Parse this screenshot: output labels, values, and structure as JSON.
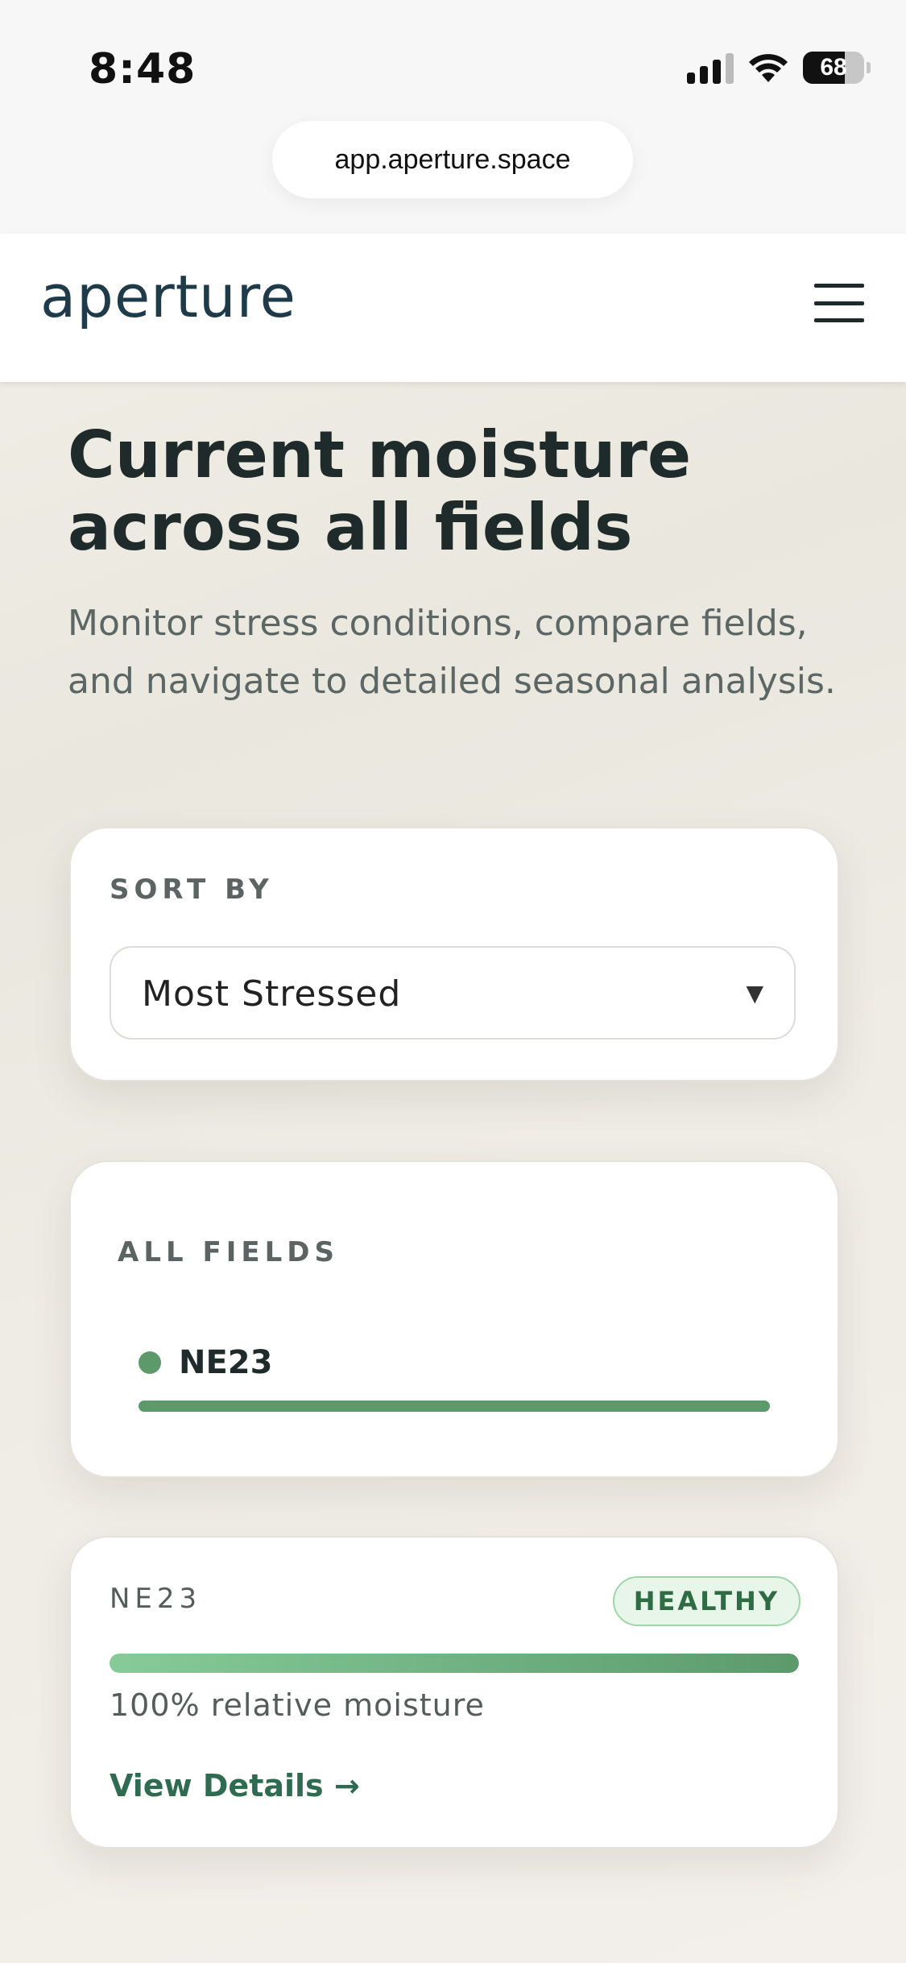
{
  "status_bar": {
    "time": "8:48",
    "battery": "68"
  },
  "browser": {
    "url": "app.aperture.space"
  },
  "header": {
    "logo": "aperture"
  },
  "hero": {
    "title": "Current moisture across all fields",
    "subtitle": "Monitor stress conditions, compare fields, and navigate to detailed seasonal analysis."
  },
  "sort": {
    "label": "SORT BY",
    "selected": "Most Stressed"
  },
  "fields": {
    "label": "ALL FIELDS",
    "items": [
      {
        "name": "NE23",
        "status_color": "#5c9a6c"
      }
    ]
  },
  "detail": {
    "name": "NE23",
    "status": "HEALTHY",
    "moisture_percent": 100,
    "moisture_text": "100% relative moisture",
    "link": "View Details →"
  },
  "colors": {
    "accent": "#5c9a6c",
    "link": "#2f6b52",
    "badge_bg": "#e8f6ea"
  }
}
